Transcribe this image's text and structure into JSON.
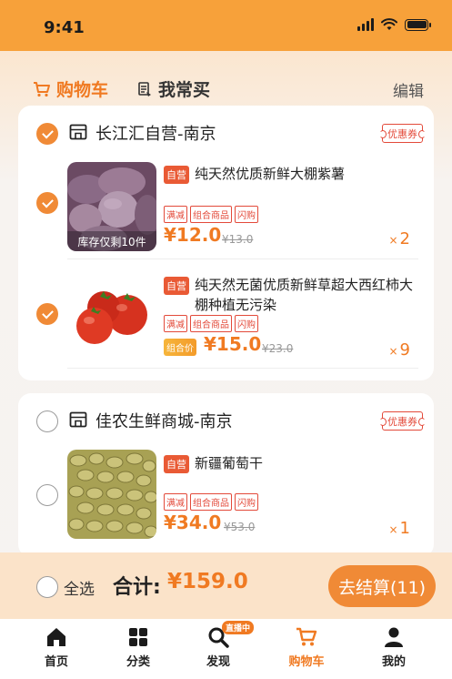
{
  "status_bar": {
    "time": "9:41"
  },
  "header": {
    "tabs": [
      {
        "label": "购物车"
      },
      {
        "label": "我常买"
      }
    ],
    "edit_label": "编辑"
  },
  "stores": [
    {
      "name": "长江汇自营-南京",
      "coupon_label": "优惠券",
      "checked": true,
      "items": [
        {
          "title": "纯天然优质新鲜大棚紫薯",
          "self_label": "自营",
          "tags": [
            "满减",
            "组合商品",
            "闪购"
          ],
          "price": "¥12.0",
          "original_price": "¥13.0",
          "quantity": "2",
          "stock_tip": "库存仅剩10件",
          "checked": true
        },
        {
          "title": "纯天然无菌优质新鲜草超大西红柿大棚种植无污染",
          "self_label": "自营",
          "tags": [
            "满减",
            "组合商品",
            "闪购"
          ],
          "combo_label": "组合价",
          "price": "¥15.0",
          "original_price": "¥23.0",
          "quantity": "9",
          "checked": true
        }
      ]
    },
    {
      "name": "佳农生鲜商城-南京",
      "coupon_label": "优惠券",
      "checked": false,
      "items": [
        {
          "title": "新疆葡萄干",
          "self_label": "自营",
          "tags": [
            "满减",
            "组合商品",
            "闪购"
          ],
          "price": "¥34.0",
          "original_price": "¥53.0",
          "quantity": "1",
          "checked": false
        }
      ]
    }
  ],
  "footer": {
    "select_all_label": "全选",
    "total_label": "合计:",
    "total_value": "¥159.0",
    "checkout_label": "去结算(11)"
  },
  "tabbar": {
    "items": [
      {
        "label": "首页",
        "icon": "home-icon"
      },
      {
        "label": "分类",
        "icon": "category-icon"
      },
      {
        "label": "发现",
        "icon": "discover-icon",
        "badge": "直播中"
      },
      {
        "label": "购物车",
        "icon": "cart-icon"
      },
      {
        "label": "我的",
        "icon": "profile-icon"
      }
    ]
  },
  "colors": {
    "accent": "#f07a22",
    "danger": "#e34a3a",
    "status_bar": "#f7a13a"
  }
}
